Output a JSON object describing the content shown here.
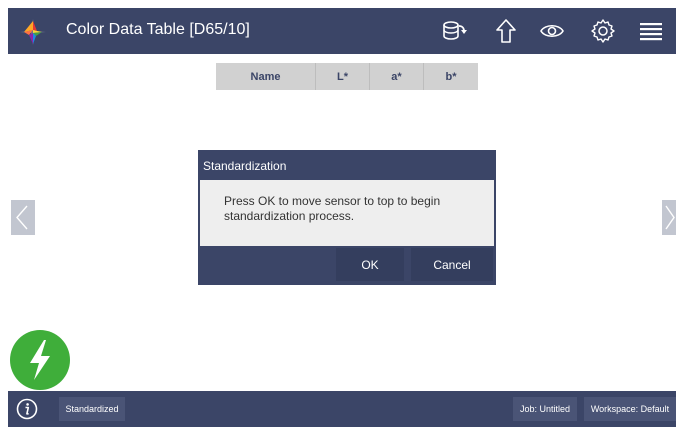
{
  "app": {
    "title": "Color Data Table [D65/10]"
  },
  "toolbar": {
    "icons": [
      "database-sync-icon",
      "upload-arrow-icon",
      "eye-icon",
      "gear-icon",
      "menu-icon"
    ]
  },
  "table": {
    "columns": [
      "Name",
      "L*",
      "a*",
      "b*"
    ]
  },
  "dialog": {
    "title": "Standardization",
    "message_line1": "Press OK to move sensor to top to begin",
    "message_line2": "standardization process.",
    "ok_label": "OK",
    "cancel_label": "Cancel"
  },
  "status": {
    "standardized_label": "Standardized",
    "job_label": "Job: Untitled",
    "workspace_label": "Workspace: Default"
  },
  "colors": {
    "bar": "#3b4567",
    "dialog_body": "#eeeeee",
    "fab": "#3fae3a"
  }
}
